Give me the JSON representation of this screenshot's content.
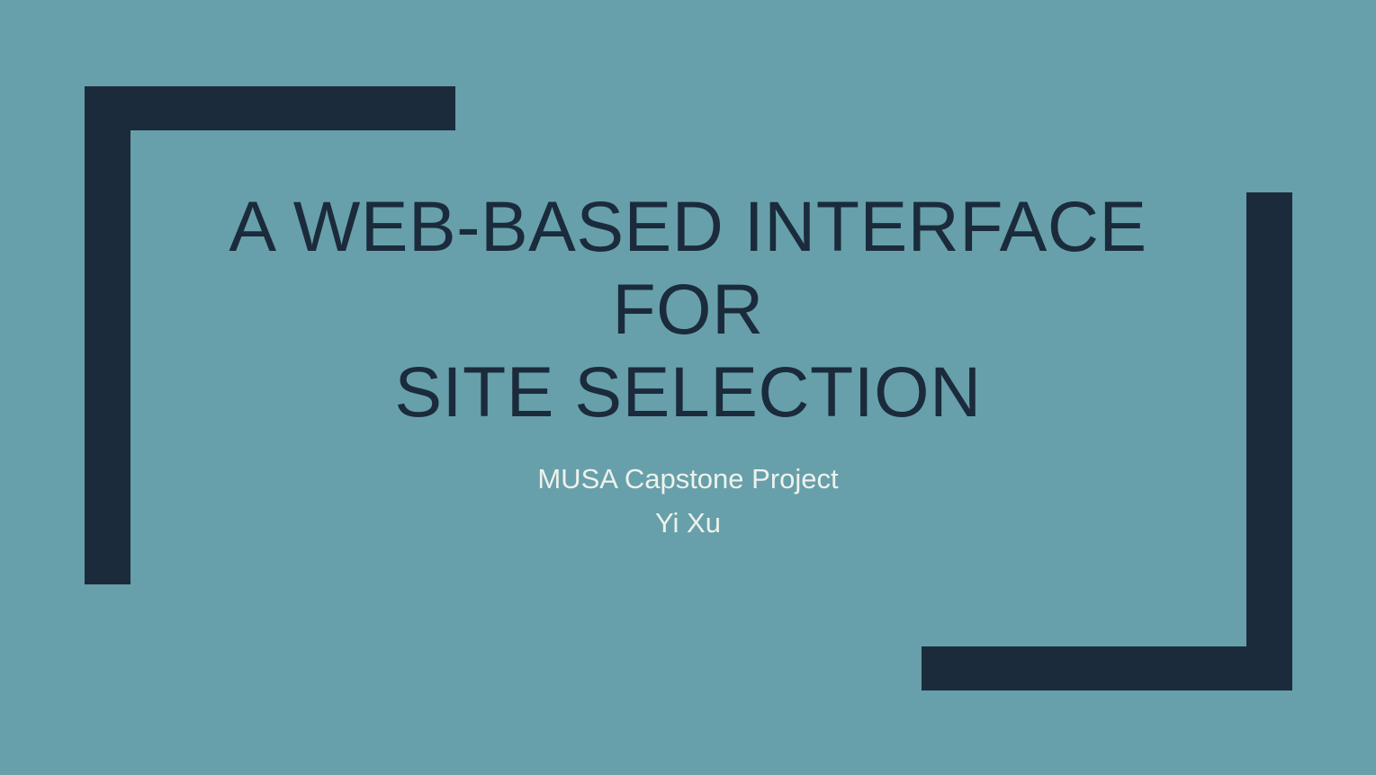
{
  "slide": {
    "title_lines": [
      "A WEB-BASED INTERFACE",
      "FOR",
      "SITE SELECTION"
    ],
    "subtitle_lines": [
      "MUSA Capstone Project",
      "Yi Xu"
    ],
    "colors": {
      "background": "#67a0aa",
      "accent": "#1b2b3c",
      "subtitle_text": "#eef2ec"
    }
  }
}
